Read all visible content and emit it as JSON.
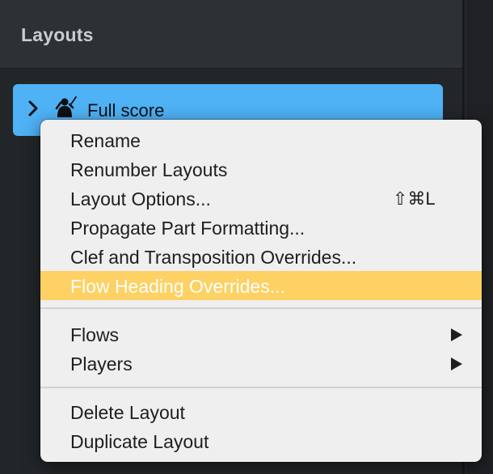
{
  "panel": {
    "title": "Layouts"
  },
  "layout_item": {
    "name": "Full score",
    "icon": "conductor-icon",
    "expand_icon": "chevron-right-icon"
  },
  "context_menu": {
    "highlight_color": "#fdd163",
    "items": [
      {
        "label": "Rename",
        "shortcut": "",
        "submenu": false,
        "highlighted": false
      },
      {
        "label": "Renumber Layouts",
        "shortcut": "",
        "submenu": false,
        "highlighted": false
      },
      {
        "label": "Layout Options...",
        "shortcut": "⇧⌘L",
        "submenu": false,
        "highlighted": false
      },
      {
        "label": "Propagate Part Formatting...",
        "shortcut": "",
        "submenu": false,
        "highlighted": false
      },
      {
        "label": "Clef and Transposition Overrides...",
        "shortcut": "",
        "submenu": false,
        "highlighted": false
      },
      {
        "label": "Flow Heading Overrides...",
        "shortcut": "",
        "submenu": false,
        "highlighted": true
      },
      {
        "label": "Flows",
        "shortcut": "",
        "submenu": true,
        "highlighted": false
      },
      {
        "label": "Players",
        "shortcut": "",
        "submenu": true,
        "highlighted": false
      },
      {
        "label": "Delete Layout",
        "shortcut": "",
        "submenu": false,
        "highlighted": false
      },
      {
        "label": "Duplicate Layout",
        "shortcut": "",
        "submenu": false,
        "highlighted": false
      }
    ]
  },
  "colors": {
    "accent_blue": "#4fb2f5",
    "panel_bg": "#232629",
    "menu_bg": "#efefef"
  }
}
